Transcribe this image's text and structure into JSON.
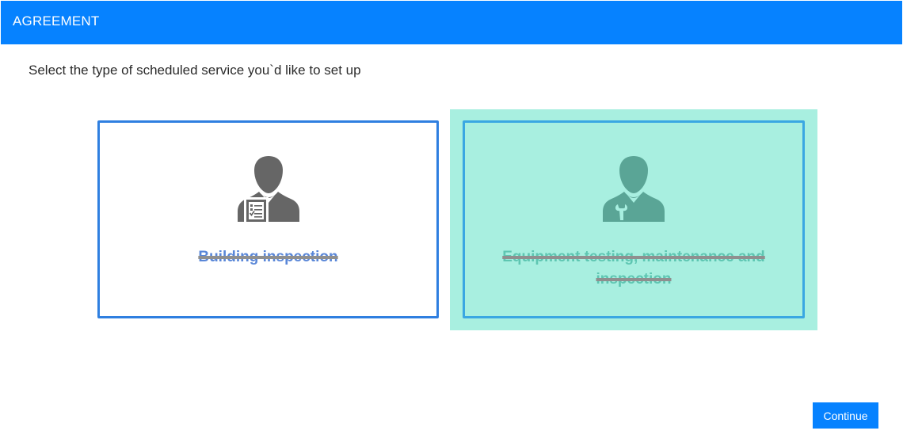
{
  "header": {
    "title": "AGREEMENT"
  },
  "prompt": "Select the type of scheduled service you`d like to set up",
  "options": [
    {
      "label": "Building inspection",
      "icon": "inspector-person-icon",
      "selected": false
    },
    {
      "label": "Equipment testing, maintenance and inspection",
      "icon": "technician-person-icon",
      "selected": true
    }
  ],
  "colors": {
    "header_bg": "#0682ff",
    "card_border": "#2f7fe0",
    "selected_bg": "#a8efe0",
    "icon_gray": "#666666",
    "icon_teal": "#5aa596"
  },
  "footer": {
    "continue_label": "Continue"
  }
}
